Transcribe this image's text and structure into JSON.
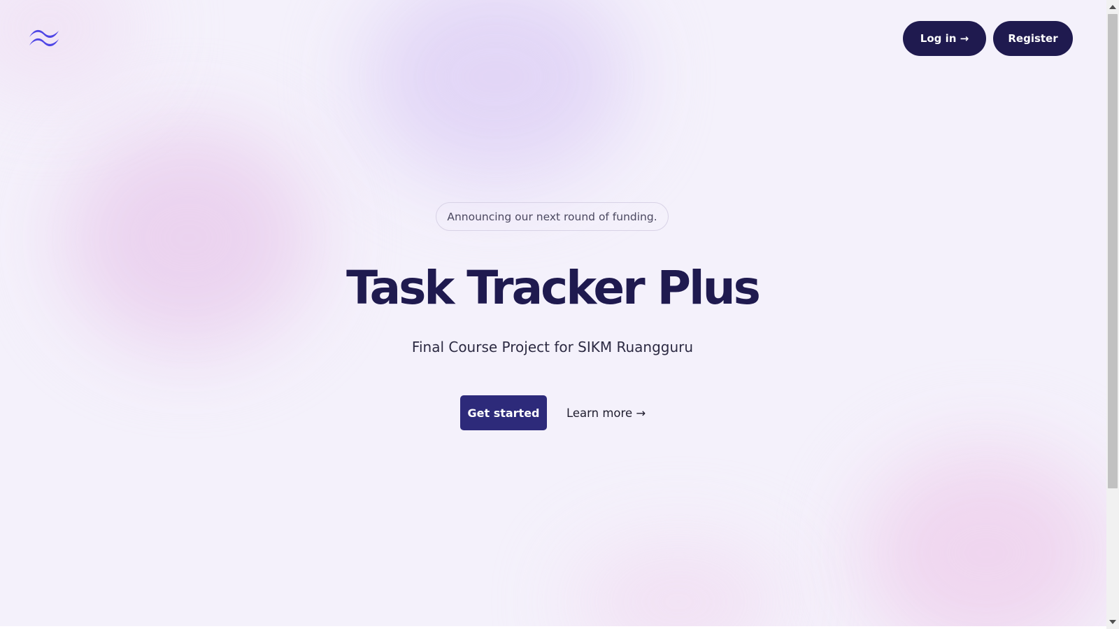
{
  "header": {
    "logo_icon": "tailwind-waves-icon",
    "login_label": "Log in →",
    "register_label": "Register"
  },
  "hero": {
    "announcement": "Announcing our next round of funding.",
    "title": "Task Tracker Plus",
    "subtitle": "Final Course Project for SIKM Ruangguru",
    "primary_cta": "Get started",
    "secondary_cta": "Learn more →"
  },
  "colors": {
    "brand_dark": "#1f1a4f",
    "primary_button": "#2d2a7a",
    "logo_blue": "#4f46e5",
    "background": "#f4f1fb"
  },
  "scrollbar": {
    "up_icon": "scroll-up-arrow-icon",
    "down_icon": "scroll-down-arrow-icon"
  }
}
